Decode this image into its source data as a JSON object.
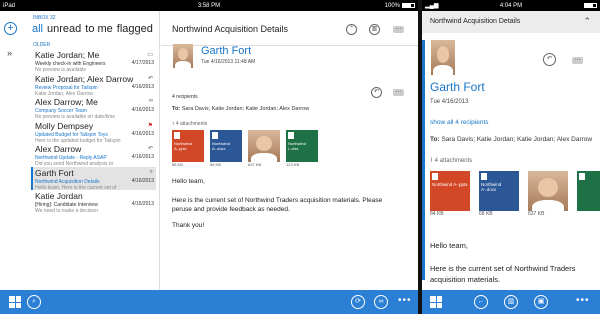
{
  "ipad": {
    "status": {
      "carrier": "iPad",
      "time": "3:58 PM",
      "battery": "100%"
    },
    "inbox_label": "INBOX 32",
    "filters": [
      "all",
      "unread",
      "to me",
      "flagged"
    ],
    "section_label": "OLDER",
    "messages": [
      {
        "sender": "Katie Jordan; Me",
        "subject": "Weekly check-in with Engineers",
        "preview": "No preview is available",
        "date": "4/17/2013",
        "subject_style": "dark"
      },
      {
        "sender": "Katie Jordan; Alex Darrow",
        "subject": "Review Proposal for Tailspin",
        "preview": "Katie Jordan, Alex Darrow",
        "date": "4/16/2013"
      },
      {
        "sender": "Alex Darrow; Me",
        "subject": "Company Soccer Team",
        "preview": "No preview is available on date/time",
        "date": "4/16/2013"
      },
      {
        "sender": "Molly Dempsey",
        "subject": "Updated Budget for Tailspin Toys",
        "preview": "Here is the updated budget for Tailspin",
        "date": "4/16/2013"
      },
      {
        "sender": "Alex Darrow",
        "subject": "Northwind Update - Reply ASAP",
        "preview": "Did you send Northwind analysis to",
        "date": "4/16/2013"
      },
      {
        "sender": "Garth Fort",
        "subject": "Northwind Acquisition Details",
        "preview": "Hello team, Here is the current set of",
        "date": "4/16/2013",
        "selected": true
      },
      {
        "sender": "Katie Jordan",
        "subject": "[Hiring]: Candidate Interview",
        "preview": "We need to make a decision",
        "date": "4/15/2013",
        "subject_style": "dark"
      }
    ],
    "reading": {
      "title": "Northwind Acquisition Details",
      "from": "Garth Fort",
      "date": "Tue 4/16/2013 11:48 AM",
      "recipients_count": "4 recipients",
      "to_label": "To:",
      "to": "Sara Davis;  Katie Jordan;  Katie Jordan;  Alex Darrow",
      "attachments_label": "4 attachments",
      "attachments": [
        {
          "name": "Northwind A-.pptx",
          "size": "86 KB",
          "color": "#d24726",
          "kind": "doc"
        },
        {
          "name": "Northwind A-.docx",
          "size": "68 KB",
          "color": "#2b5797",
          "kind": "doc"
        },
        {
          "name": "",
          "size": "637 KB",
          "color": "#777777",
          "kind": "photo"
        },
        {
          "name": "Northwind I-.xlsx",
          "size": "123 KB",
          "color": "#1e7145",
          "kind": "doc"
        }
      ],
      "greeting": "Hello team,",
      "body": "Here is the current set of Northwind Traders acquisition materials.  Please peruse and provide feedback as needed.",
      "closing": "Thank you!"
    }
  },
  "phone": {
    "status": {
      "time": "4:04 PM"
    },
    "title": "Northwind Acquisition Details",
    "from": "Garth Fort",
    "date": "Tue 4/16/2013",
    "show_recipients": "show all 4 recipients",
    "to_label": "To:",
    "to": "Sara Davis;  Katie Jordan;  Katie Jordan;  Alex Darrow",
    "attachments_label": "4 attachments",
    "attachments": [
      {
        "name": "Northwind A-.pptx",
        "size": "84 KB",
        "color": "#d24726",
        "kind": "doc"
      },
      {
        "name": "Northwind A-.docx",
        "size": "68 KB",
        "color": "#2b5797",
        "kind": "doc"
      },
      {
        "name": "",
        "size": "637 KB",
        "color": "#777777",
        "kind": "photo"
      },
      {
        "name": "",
        "size": "",
        "color": "#1e7145",
        "kind": "doc"
      }
    ],
    "greeting": "Hello team,",
    "body": "Here is the current set of Northwind Traders acquisition materials."
  },
  "colors": {
    "accent": "#1976c8",
    "appbar": "#2b7fd4"
  }
}
